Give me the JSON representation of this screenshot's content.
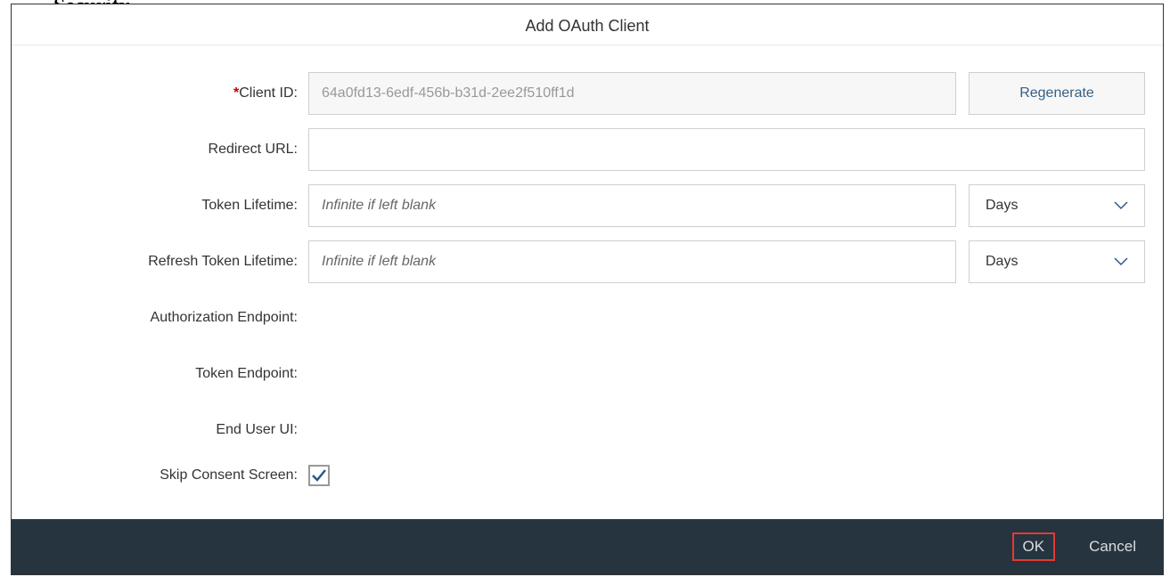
{
  "dialog": {
    "title": "Add OAuth Client"
  },
  "form": {
    "client_id": {
      "label": "Client ID:",
      "value": "64a0fd13-6edf-456b-b31d-2ee2f510ff1d",
      "regenerate_label": "Regenerate"
    },
    "redirect_url": {
      "label": "Redirect URL:",
      "value": ""
    },
    "token_lifetime": {
      "label": "Token Lifetime:",
      "placeholder": "Infinite if left blank",
      "value": "",
      "unit": "Days"
    },
    "refresh_token_lifetime": {
      "label": "Refresh Token Lifetime:",
      "placeholder": "Infinite if left blank",
      "value": "",
      "unit": "Days"
    },
    "authorization_endpoint": {
      "label": "Authorization Endpoint:",
      "value": ""
    },
    "token_endpoint": {
      "label": "Token Endpoint:",
      "value": ""
    },
    "end_user_ui": {
      "label": "End User UI:",
      "value": ""
    },
    "skip_consent": {
      "label": "Skip Consent Screen:",
      "checked": true
    }
  },
  "footer": {
    "ok": "OK",
    "cancel": "Cancel"
  }
}
